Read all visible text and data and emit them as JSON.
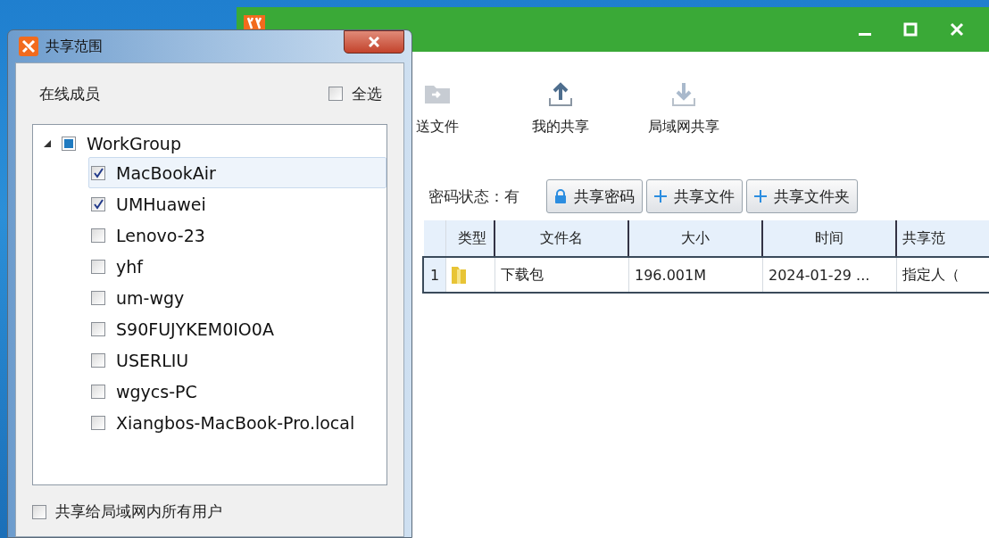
{
  "main_window": {
    "toolbar": [
      {
        "kind": "send",
        "label": "送文件"
      },
      {
        "kind": "upload",
        "label": "我的共享"
      },
      {
        "kind": "download",
        "label": "局域网共享"
      }
    ],
    "password_status": {
      "label": "密码状态：",
      "value": "有"
    },
    "buttons": [
      {
        "kind": "lock",
        "label": "共享密码"
      },
      {
        "kind": "plus",
        "label": "共享文件"
      },
      {
        "kind": "plus",
        "label": "共享文件夹"
      }
    ],
    "table": {
      "columns": [
        "类型",
        "文件名",
        "大小",
        "时间",
        "共享范"
      ],
      "rows": [
        {
          "index": "1",
          "selected": true,
          "cells": [
            "",
            "下载包",
            "196.001M",
            "2024-01-29 ...",
            "指定人（"
          ]
        }
      ]
    }
  },
  "dialog": {
    "title": "共享范围",
    "members_label": "在线成员",
    "select_all": {
      "label": "全选",
      "checked": false
    },
    "tree": [
      {
        "label": "WorkGroup",
        "expanded": true,
        "indeterminate": true,
        "children": [
          {
            "label": "MacBookAir",
            "checked": true,
            "selected": true
          },
          {
            "label": "UMHuawei",
            "checked": true,
            "selected": false
          },
          {
            "label": "Lenovo-23",
            "checked": false,
            "selected": false
          },
          {
            "label": "yhf",
            "checked": false,
            "selected": false
          },
          {
            "label": "um-wgy",
            "checked": false,
            "selected": false
          },
          {
            "label": "S90FUJYKEM0IO0A",
            "checked": false,
            "selected": false
          },
          {
            "label": "USERLIU",
            "checked": false,
            "selected": false
          },
          {
            "label": "wgycs-PC",
            "checked": false,
            "selected": false
          },
          {
            "label": "Xiangbos-MacBook-Pro.local",
            "checked": false,
            "selected": false
          }
        ]
      }
    ],
    "share_all": {
      "label": "共享给局域网内所有用户",
      "checked": false
    }
  }
}
